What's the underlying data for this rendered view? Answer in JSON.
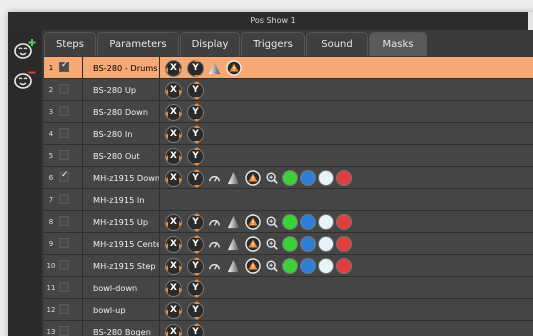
{
  "window": {
    "title": "Pos Show 1"
  },
  "sidebar": {
    "add_icon": "add-show-icon",
    "remove_icon": "remove-show-icon"
  },
  "tabs": [
    {
      "label": "Steps",
      "active": false
    },
    {
      "label": "Parameters",
      "active": false
    },
    {
      "label": "Display",
      "active": false
    },
    {
      "label": "Triggers",
      "active": false
    },
    {
      "label": "Sound",
      "active": false
    },
    {
      "label": "Masks",
      "active": true
    }
  ],
  "colors": {
    "selected_row": "#f6a875",
    "green": "#3bd13b",
    "blue": "#2d7fd8",
    "white": "#e6f3fb",
    "red": "#e33c3c",
    "axis_arrow": "#e68a3a"
  },
  "rows": [
    {
      "num": "1",
      "checked": true,
      "name": "BS-280 - Drums",
      "selected": true,
      "icons": [
        "pan-x-icon",
        "tilt-y-icon",
        "beam-cone-icon",
        "warning-icon"
      ]
    },
    {
      "num": "2",
      "checked": false,
      "name": "BS-280 Up",
      "icons": [
        "pan-x-icon",
        "tilt-y-icon"
      ]
    },
    {
      "num": "3",
      "checked": false,
      "name": "BS-280 Down",
      "icons": [
        "pan-x-icon",
        "tilt-y-icon"
      ]
    },
    {
      "num": "4",
      "checked": false,
      "name": "BS-280 In",
      "icons": [
        "pan-x-icon",
        "tilt-y-icon"
      ]
    },
    {
      "num": "5",
      "checked": false,
      "name": "BS-280 Out",
      "icons": [
        "pan-x-icon",
        "tilt-y-icon"
      ]
    },
    {
      "num": "6",
      "checked": true,
      "name": "MH-z1915 Down",
      "icons": [
        "pan-x-icon",
        "tilt-y-icon",
        "dimmer-icon",
        "beam-cone-icon",
        "warning-icon",
        "zoom-icon",
        "color-green",
        "color-blue",
        "color-white",
        "color-red"
      ]
    },
    {
      "num": "7",
      "checked": false,
      "name": "MH-z1915 In",
      "icons": []
    },
    {
      "num": "8",
      "checked": false,
      "name": "MH-z1915 Up",
      "icons": [
        "pan-x-icon",
        "tilt-y-icon",
        "dimmer-icon",
        "beam-cone-icon",
        "warning-icon",
        "zoom-icon",
        "color-green",
        "color-blue",
        "color-white",
        "color-red"
      ]
    },
    {
      "num": "9",
      "checked": false,
      "name": "MH-z1915 Center",
      "icons": [
        "pan-x-icon",
        "tilt-y-icon",
        "dimmer-icon",
        "beam-cone-icon",
        "warning-icon",
        "zoom-icon",
        "color-green",
        "color-blue",
        "color-white",
        "color-red"
      ]
    },
    {
      "num": "10",
      "checked": false,
      "name": "MH-z1915 Step",
      "icons": [
        "pan-x-icon",
        "tilt-y-icon",
        "dimmer-icon",
        "beam-cone-icon",
        "warning-icon",
        "zoom-icon",
        "color-green",
        "color-blue",
        "color-white",
        "color-red"
      ]
    },
    {
      "num": "11",
      "checked": false,
      "name": "bowl-down",
      "icons": [
        "pan-x-icon",
        "tilt-y-icon"
      ]
    },
    {
      "num": "12",
      "checked": false,
      "name": "bowl-up",
      "icons": [
        "pan-x-icon",
        "tilt-y-icon"
      ]
    },
    {
      "num": "13",
      "checked": false,
      "name": "BS-280 Bogen",
      "icons": [
        "pan-x-icon",
        "tilt-y-icon"
      ]
    }
  ]
}
